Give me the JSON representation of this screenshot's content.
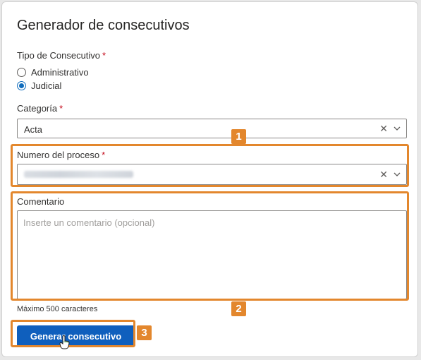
{
  "form": {
    "title": "Generador de consecutivos",
    "tipo_label": "Tipo de Consecutivo",
    "required_mark": "*",
    "radio_options": [
      "Administrativo",
      "Judicial"
    ],
    "radio_selected": "Judicial",
    "categoria_label": "Categoría",
    "categoria_value": "Acta",
    "proceso_label": "Numero del proceso",
    "clear_glyph": "✕",
    "comentario_label": "Comentario",
    "comentario_placeholder": "Inserte un comentario (opcional)",
    "comentario_hint": "Máximo 500 caracteres",
    "submit_label": "Generar consecutivo"
  },
  "callouts": [
    "1",
    "2",
    "3"
  ],
  "colors": {
    "accent": "#0f6cbd",
    "button": "#0f5fbd",
    "callout": "#e3872d",
    "required": "#c50f1f"
  },
  "icons": [
    "chevron-down-icon",
    "clear-icon",
    "hand-cursor-icon"
  ]
}
